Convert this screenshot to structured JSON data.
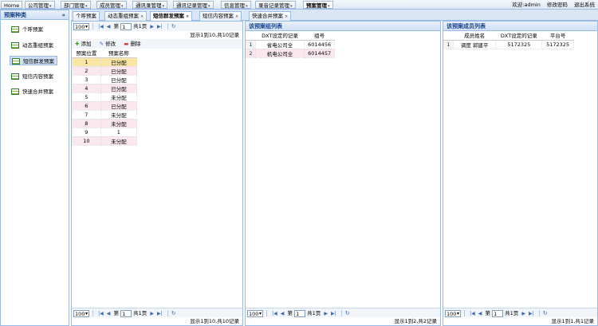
{
  "topnav": {
    "tabs": [
      {
        "label": "Home",
        "arrow": false
      },
      {
        "label": "公司管理",
        "arrow": true
      },
      {
        "label": "部门管理",
        "arrow": true
      },
      {
        "label": "成员管理",
        "arrow": true
      },
      {
        "label": "通讯录管理",
        "arrow": true
      },
      {
        "label": "通讯记录管理",
        "arrow": true
      },
      {
        "label": "信息管理",
        "arrow": true
      },
      {
        "label": "录音记录管理",
        "arrow": true
      },
      {
        "label": "预案管理",
        "arrow": true
      }
    ],
    "welcome": "欢迎:admin",
    "change_password": "修改密码",
    "logout": "退出系统"
  },
  "sidebar": {
    "title": "预案种类",
    "collapse_icon": "«",
    "items": [
      {
        "label": "个呼预案"
      },
      {
        "label": "动态重组预案"
      },
      {
        "label": "短信群发预案"
      },
      {
        "label": "短信内容预案"
      },
      {
        "label": "快速合并预案"
      }
    ]
  },
  "tabs": [
    {
      "label": "个呼预案"
    },
    {
      "label": "动态重组预案"
    },
    {
      "label": "短信群发预案"
    },
    {
      "label": "短信内容预案"
    },
    {
      "label": "快速合并预案"
    }
  ],
  "left_pane": {
    "pager": {
      "page_size": "100",
      "page_label": "第",
      "page_value": "1",
      "total_pages": "共1页"
    },
    "status_top": "显示1到10,共10记录",
    "toolbar": {
      "add": "添加",
      "edit": "修改",
      "delete": "删除"
    },
    "columns": [
      "预案位置",
      "预案名称"
    ],
    "rows": [
      [
        "1",
        "已分配"
      ],
      [
        "2",
        "已分配"
      ],
      [
        "3",
        "已分配"
      ],
      [
        "4",
        "已分配"
      ],
      [
        "5",
        "未分配"
      ],
      [
        "6",
        "已分配"
      ],
      [
        "7",
        "未分配"
      ],
      [
        "8",
        "未分配"
      ],
      [
        "9",
        "1"
      ],
      [
        "10",
        "未分配"
      ]
    ],
    "pager_bottom": {
      "page_size": "100",
      "page_label": "第",
      "page_value": "1",
      "total_pages": "共1页"
    },
    "status_bottom": "显示1到10,共10记录"
  },
  "mid_pane": {
    "title": "该预案组列表",
    "columns": [
      "",
      "DXT设定的记录",
      "组号"
    ],
    "rows": [
      [
        "1",
        "省电公司全",
        "6014456"
      ],
      [
        "2",
        "机电公司全",
        "6014457"
      ]
    ],
    "pager_bottom": {
      "page_size": "100",
      "page_label": "第",
      "page_value": "1",
      "total_pages": "共1页"
    },
    "status_bottom": "显示1到2,共2记录"
  },
  "right_pane": {
    "title": "该预案成员列表",
    "columns": [
      "",
      "成员姓名",
      "DXT设定的记录",
      "平台号"
    ],
    "rows": [
      [
        "1",
        "调度 郭建平",
        "5172325",
        "5172325"
      ]
    ],
    "pager_bottom": {
      "page_size": "100",
      "page_label": "第",
      "page_value": "1",
      "total_pages": "共1页"
    },
    "status_bottom": "显示1到1,共1记录"
  },
  "colors": {
    "accent": "#99bbe8",
    "header_text": "#15428b",
    "selected_row": "#fbe5a4",
    "alt_row": "#fbe8ef"
  }
}
